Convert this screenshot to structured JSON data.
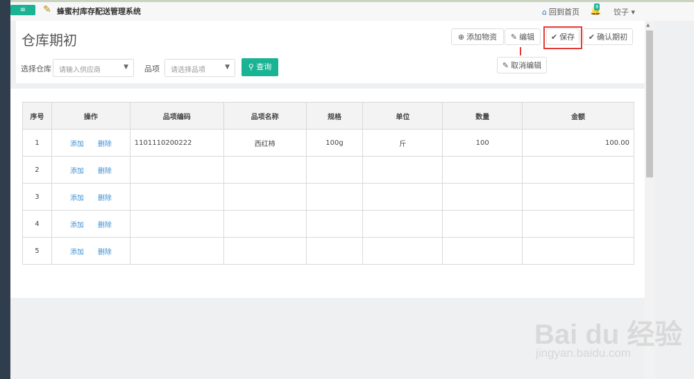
{
  "topbar": {
    "menu_icon": "menu-icon",
    "app_title": "蜂蜜村库存配送管理系统",
    "home_link": "回到首页",
    "notification_count": "8",
    "user": "饺子 ▾"
  },
  "page": {
    "title": "仓库期初",
    "buttons": {
      "add_material": "添加物资",
      "edit": "编辑",
      "save": "保存",
      "confirm": "确认期初",
      "cancel_edit": "取消编辑"
    }
  },
  "filters": {
    "warehouse_label": "选择仓库",
    "warehouse_placeholder": "请输入供应商",
    "item_label": "品项",
    "item_placeholder": "请选择品项",
    "search_label": "查询"
  },
  "table": {
    "headers": [
      "序号",
      "操作",
      "品项编码",
      "品项名称",
      "规格",
      "单位",
      "数量",
      "金额"
    ],
    "add_label": "添加",
    "delete_label": "删除",
    "rows": [
      {
        "no": "1",
        "code": "1101110200222",
        "name": "西红柿",
        "spec": "100g",
        "unit": "斤",
        "qty": "100",
        "amount": "100.00"
      },
      {
        "no": "2",
        "code": "",
        "name": "",
        "spec": "",
        "unit": "",
        "qty": "",
        "amount": ""
      },
      {
        "no": "3",
        "code": "",
        "name": "",
        "spec": "",
        "unit": "",
        "qty": "",
        "amount": ""
      },
      {
        "no": "4",
        "code": "",
        "name": "",
        "spec": "",
        "unit": "",
        "qty": "",
        "amount": ""
      },
      {
        "no": "5",
        "code": "",
        "name": "",
        "spec": "",
        "unit": "",
        "qty": "",
        "amount": ""
      }
    ]
  },
  "watermark": {
    "main": "Bai du 经验",
    "sub": "jingyan.baidu.com"
  },
  "colors": {
    "accent": "#1ab394",
    "highlight": "#e53935",
    "link": "#3d8fd4",
    "sidebar": "#2f3d4c"
  }
}
